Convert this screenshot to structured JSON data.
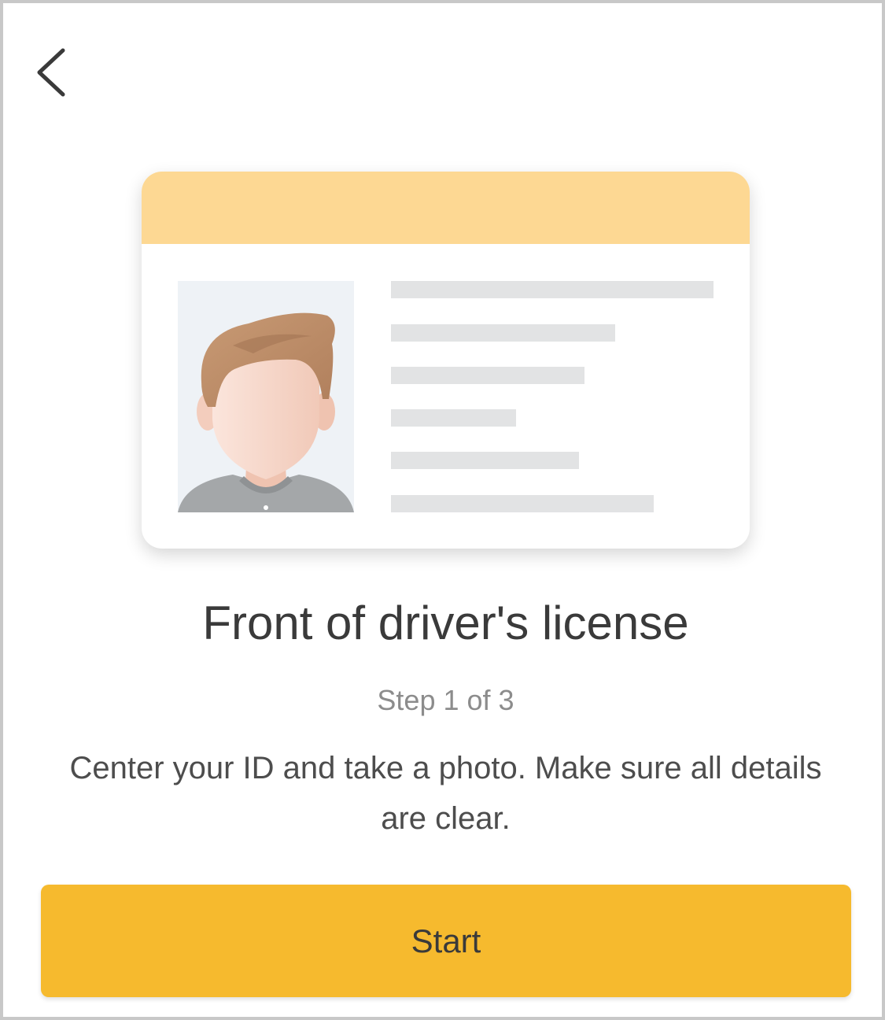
{
  "header": {
    "back_icon": "chevron-left-icon"
  },
  "illustration": {
    "colors": {
      "header_band": "#fdd893",
      "text_lines": "#e2e3e4",
      "photo_bg": "#eef2f6",
      "hair": "#c89a74",
      "skin": "#f7d9cc",
      "shirt": "#a4a7a9"
    }
  },
  "content": {
    "title": "Front of driver's license",
    "step": "Step 1 of 3",
    "description": "Center your ID and take a photo. Make sure all details are clear."
  },
  "actions": {
    "start_label": "Start",
    "accent": "#f6ba2e"
  }
}
